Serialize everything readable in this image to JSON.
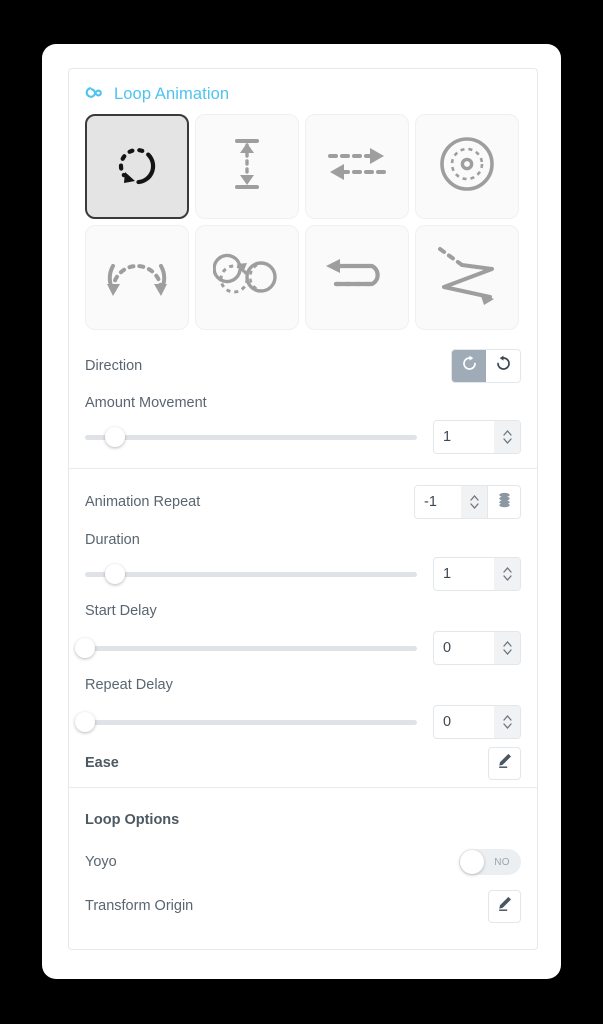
{
  "header": {
    "title": "Loop Animation",
    "icon": "infinity-icon",
    "accent_color": "#4ec3f0"
  },
  "presets": {
    "selected_index": 0,
    "tiles": [
      {
        "name": "rotate-loop",
        "icon": "rotate-dashed-arrow-icon",
        "selected": true
      },
      {
        "name": "vertical-movement",
        "icon": "vertical-double-arrow-icon",
        "selected": false
      },
      {
        "name": "horizontal-movement",
        "icon": "horizontal-dashed-arrows-icon",
        "selected": false
      },
      {
        "name": "orbit",
        "icon": "concentric-circles-icon",
        "selected": false
      },
      {
        "name": "arc-swing",
        "icon": "arc-two-arrows-icon",
        "selected": false
      },
      {
        "name": "circle-morph",
        "icon": "circle-morph-icon",
        "selected": false
      },
      {
        "name": "u-turn-loop",
        "icon": "u-turn-dashed-arrow-icon",
        "selected": false
      },
      {
        "name": "zigzag-path",
        "icon": "zigzag-arrow-icon",
        "selected": false
      }
    ]
  },
  "controls": {
    "direction": {
      "label": "Direction",
      "options": [
        {
          "name": "clockwise",
          "icon": "rotate-cw-icon",
          "selected": true
        },
        {
          "name": "counter-clockwise",
          "icon": "rotate-ccw-icon",
          "selected": false
        }
      ]
    },
    "amount_movement": {
      "label": "Amount Movement",
      "value": "1",
      "slider_percent": 9
    },
    "animation_repeat": {
      "label": "Animation Repeat",
      "value": "-1",
      "extra_button_icon": "database-stack-icon"
    },
    "duration": {
      "label": "Duration",
      "value": "1",
      "slider_percent": 9
    },
    "start_delay": {
      "label": "Start Delay",
      "value": "0",
      "slider_percent": 0
    },
    "repeat_delay": {
      "label": "Repeat Delay",
      "value": "0",
      "slider_percent": 0
    },
    "ease": {
      "label": "Ease",
      "edit_icon": "pencil-icon"
    }
  },
  "loop_options": {
    "title": "Loop Options",
    "yoyo": {
      "label": "Yoyo",
      "state": "NO",
      "enabled": false
    },
    "transform_origin": {
      "label": "Transform Origin",
      "edit_icon": "pencil-icon"
    }
  }
}
